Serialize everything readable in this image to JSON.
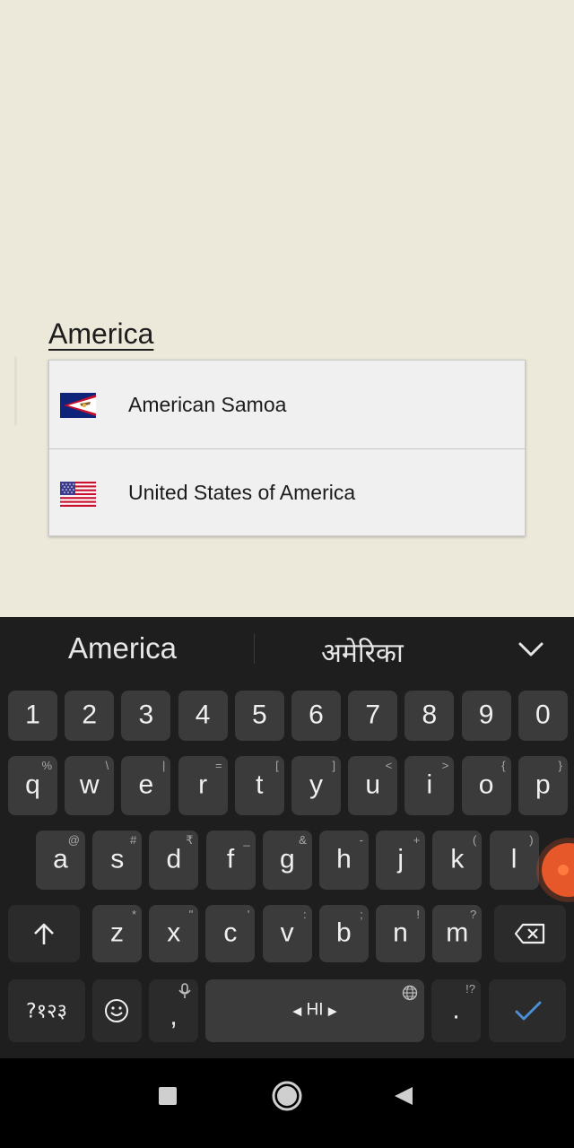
{
  "search": {
    "query": "America"
  },
  "results": [
    {
      "label": "American Samoa",
      "flag": "american-samoa-flag"
    },
    {
      "label": "United States of America",
      "flag": "usa-flag"
    }
  ],
  "keyboard": {
    "suggestions": {
      "primary": "America",
      "secondary": "अमेरिका"
    },
    "numbers": [
      "1",
      "2",
      "3",
      "4",
      "5",
      "6",
      "7",
      "8",
      "9",
      "0"
    ],
    "row1": [
      {
        "k": "q",
        "h": "%"
      },
      {
        "k": "w",
        "h": "\\"
      },
      {
        "k": "e",
        "h": "|"
      },
      {
        "k": "r",
        "h": "="
      },
      {
        "k": "t",
        "h": "["
      },
      {
        "k": "y",
        "h": "]"
      },
      {
        "k": "u",
        "h": "<"
      },
      {
        "k": "i",
        "h": ">"
      },
      {
        "k": "o",
        "h": "{"
      },
      {
        "k": "p",
        "h": "}"
      }
    ],
    "row2": [
      {
        "k": "a",
        "h": "@"
      },
      {
        "k": "s",
        "h": "#"
      },
      {
        "k": "d",
        "h": "₹"
      },
      {
        "k": "f",
        "h": "_"
      },
      {
        "k": "g",
        "h": "&"
      },
      {
        "k": "h",
        "h": "-"
      },
      {
        "k": "j",
        "h": "+"
      },
      {
        "k": "k",
        "h": "("
      },
      {
        "k": "l",
        "h": ")"
      }
    ],
    "row3": [
      {
        "k": "z",
        "h": "*"
      },
      {
        "k": "x",
        "h": "\""
      },
      {
        "k": "c",
        "h": "'"
      },
      {
        "k": "v",
        "h": ":"
      },
      {
        "k": "b",
        "h": ";"
      },
      {
        "k": "n",
        "h": "!"
      },
      {
        "k": "m",
        "h": "?"
      }
    ],
    "symbols_label": "?१२३",
    "comma": ",",
    "period": ".",
    "period_hint": "!?",
    "space_label": "HI"
  },
  "colors": {
    "accent": "#4a8fd6",
    "keyboard_bg": "#1e1e1e",
    "key": "#3b3b3b",
    "page_bg": "#ece8da"
  }
}
